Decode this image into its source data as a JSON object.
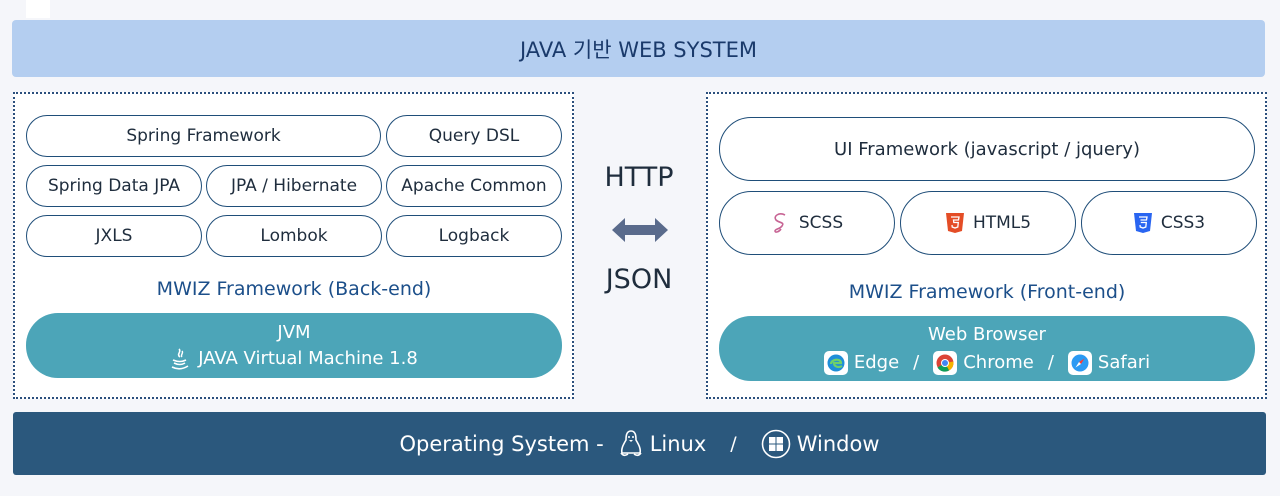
{
  "title": "JAVA 기반 WEB SYSTEM",
  "backend": {
    "components": [
      "Spring Framework",
      "Query DSL",
      "Spring Data JPA",
      "JPA / Hibernate",
      "Apache Common",
      "JXLS",
      "Lombok",
      "Logback"
    ],
    "framework_label": "MWIZ Framework (Back-end)",
    "jvm": {
      "line1": "JVM",
      "line2": "JAVA Virtual Machine 1.8"
    }
  },
  "protocol": {
    "top": "HTTP",
    "bottom": "JSON"
  },
  "frontend": {
    "ui_framework": "UI Framework (javascript / jquery)",
    "styles": [
      "SCSS",
      "HTML5",
      "CSS3"
    ],
    "framework_label": "MWIZ Framework (Front-end)",
    "browser": {
      "title": "Web Browser",
      "items": [
        "Edge",
        "Chrome",
        "Safari"
      ],
      "separator": "/"
    }
  },
  "os": {
    "prefix": "Operating System -",
    "items": [
      "Linux",
      "Window"
    ],
    "separator": "/"
  },
  "colors": {
    "banner": "#b4cef0",
    "teal": "#4ca5b8",
    "os_bar": "#2b587d",
    "border": "#1f4e79"
  }
}
